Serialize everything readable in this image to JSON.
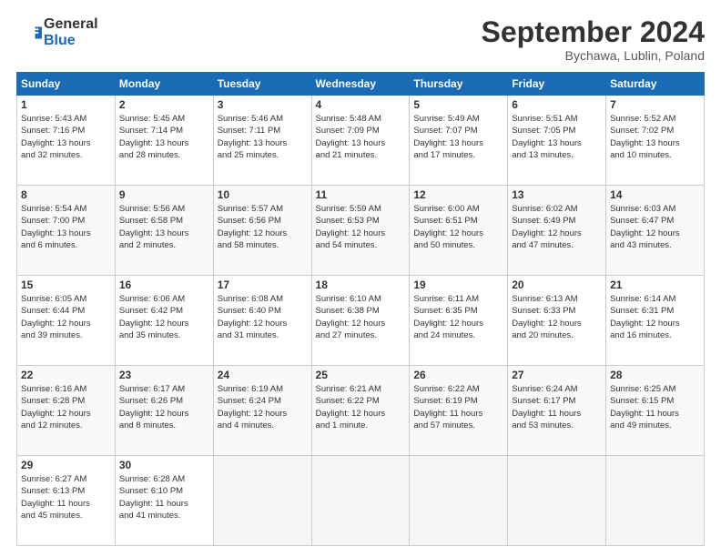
{
  "header": {
    "logo_general": "General",
    "logo_blue": "Blue",
    "month_title": "September 2024",
    "location": "Bychawa, Lublin, Poland"
  },
  "days_of_week": [
    "Sunday",
    "Monday",
    "Tuesday",
    "Wednesday",
    "Thursday",
    "Friday",
    "Saturday"
  ],
  "weeks": [
    [
      {
        "day": "1",
        "info": "Sunrise: 5:43 AM\nSunset: 7:16 PM\nDaylight: 13 hours\nand 32 minutes."
      },
      {
        "day": "2",
        "info": "Sunrise: 5:45 AM\nSunset: 7:14 PM\nDaylight: 13 hours\nand 28 minutes."
      },
      {
        "day": "3",
        "info": "Sunrise: 5:46 AM\nSunset: 7:11 PM\nDaylight: 13 hours\nand 25 minutes."
      },
      {
        "day": "4",
        "info": "Sunrise: 5:48 AM\nSunset: 7:09 PM\nDaylight: 13 hours\nand 21 minutes."
      },
      {
        "day": "5",
        "info": "Sunrise: 5:49 AM\nSunset: 7:07 PM\nDaylight: 13 hours\nand 17 minutes."
      },
      {
        "day": "6",
        "info": "Sunrise: 5:51 AM\nSunset: 7:05 PM\nDaylight: 13 hours\nand 13 minutes."
      },
      {
        "day": "7",
        "info": "Sunrise: 5:52 AM\nSunset: 7:02 PM\nDaylight: 13 hours\nand 10 minutes."
      }
    ],
    [
      {
        "day": "8",
        "info": "Sunrise: 5:54 AM\nSunset: 7:00 PM\nDaylight: 13 hours\nand 6 minutes."
      },
      {
        "day": "9",
        "info": "Sunrise: 5:56 AM\nSunset: 6:58 PM\nDaylight: 13 hours\nand 2 minutes."
      },
      {
        "day": "10",
        "info": "Sunrise: 5:57 AM\nSunset: 6:56 PM\nDaylight: 12 hours\nand 58 minutes."
      },
      {
        "day": "11",
        "info": "Sunrise: 5:59 AM\nSunset: 6:53 PM\nDaylight: 12 hours\nand 54 minutes."
      },
      {
        "day": "12",
        "info": "Sunrise: 6:00 AM\nSunset: 6:51 PM\nDaylight: 12 hours\nand 50 minutes."
      },
      {
        "day": "13",
        "info": "Sunrise: 6:02 AM\nSunset: 6:49 PM\nDaylight: 12 hours\nand 47 minutes."
      },
      {
        "day": "14",
        "info": "Sunrise: 6:03 AM\nSunset: 6:47 PM\nDaylight: 12 hours\nand 43 minutes."
      }
    ],
    [
      {
        "day": "15",
        "info": "Sunrise: 6:05 AM\nSunset: 6:44 PM\nDaylight: 12 hours\nand 39 minutes."
      },
      {
        "day": "16",
        "info": "Sunrise: 6:06 AM\nSunset: 6:42 PM\nDaylight: 12 hours\nand 35 minutes."
      },
      {
        "day": "17",
        "info": "Sunrise: 6:08 AM\nSunset: 6:40 PM\nDaylight: 12 hours\nand 31 minutes."
      },
      {
        "day": "18",
        "info": "Sunrise: 6:10 AM\nSunset: 6:38 PM\nDaylight: 12 hours\nand 27 minutes."
      },
      {
        "day": "19",
        "info": "Sunrise: 6:11 AM\nSunset: 6:35 PM\nDaylight: 12 hours\nand 24 minutes."
      },
      {
        "day": "20",
        "info": "Sunrise: 6:13 AM\nSunset: 6:33 PM\nDaylight: 12 hours\nand 20 minutes."
      },
      {
        "day": "21",
        "info": "Sunrise: 6:14 AM\nSunset: 6:31 PM\nDaylight: 12 hours\nand 16 minutes."
      }
    ],
    [
      {
        "day": "22",
        "info": "Sunrise: 6:16 AM\nSunset: 6:28 PM\nDaylight: 12 hours\nand 12 minutes."
      },
      {
        "day": "23",
        "info": "Sunrise: 6:17 AM\nSunset: 6:26 PM\nDaylight: 12 hours\nand 8 minutes."
      },
      {
        "day": "24",
        "info": "Sunrise: 6:19 AM\nSunset: 6:24 PM\nDaylight: 12 hours\nand 4 minutes."
      },
      {
        "day": "25",
        "info": "Sunrise: 6:21 AM\nSunset: 6:22 PM\nDaylight: 12 hours\nand 1 minute."
      },
      {
        "day": "26",
        "info": "Sunrise: 6:22 AM\nSunset: 6:19 PM\nDaylight: 11 hours\nand 57 minutes."
      },
      {
        "day": "27",
        "info": "Sunrise: 6:24 AM\nSunset: 6:17 PM\nDaylight: 11 hours\nand 53 minutes."
      },
      {
        "day": "28",
        "info": "Sunrise: 6:25 AM\nSunset: 6:15 PM\nDaylight: 11 hours\nand 49 minutes."
      }
    ],
    [
      {
        "day": "29",
        "info": "Sunrise: 6:27 AM\nSunset: 6:13 PM\nDaylight: 11 hours\nand 45 minutes."
      },
      {
        "day": "30",
        "info": "Sunrise: 6:28 AM\nSunset: 6:10 PM\nDaylight: 11 hours\nand 41 minutes."
      },
      {
        "day": "",
        "info": ""
      },
      {
        "day": "",
        "info": ""
      },
      {
        "day": "",
        "info": ""
      },
      {
        "day": "",
        "info": ""
      },
      {
        "day": "",
        "info": ""
      }
    ]
  ]
}
